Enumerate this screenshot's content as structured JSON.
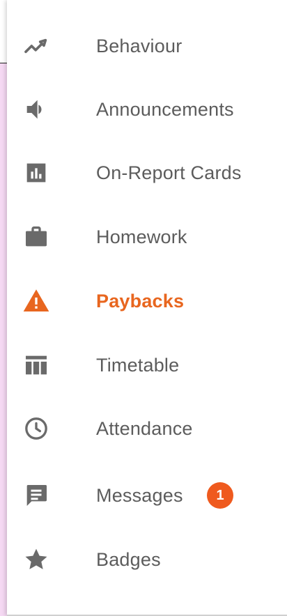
{
  "menu": {
    "accent_color": "#e8661f",
    "items": [
      {
        "label": "Behaviour",
        "icon": "trending-line-icon"
      },
      {
        "label": "Announcements",
        "icon": "speaker-icon"
      },
      {
        "label": "On-Report Cards",
        "icon": "bar-chart-icon"
      },
      {
        "label": "Homework",
        "icon": "briefcase-icon"
      },
      {
        "label": "Paybacks",
        "icon": "warning-icon",
        "active": true
      },
      {
        "label": "Timetable",
        "icon": "table-icon"
      },
      {
        "label": "Attendance",
        "icon": "clock-icon"
      },
      {
        "label": "Messages",
        "icon": "message-icon",
        "badge": "1"
      },
      {
        "label": "Badges",
        "icon": "star-icon"
      }
    ]
  }
}
